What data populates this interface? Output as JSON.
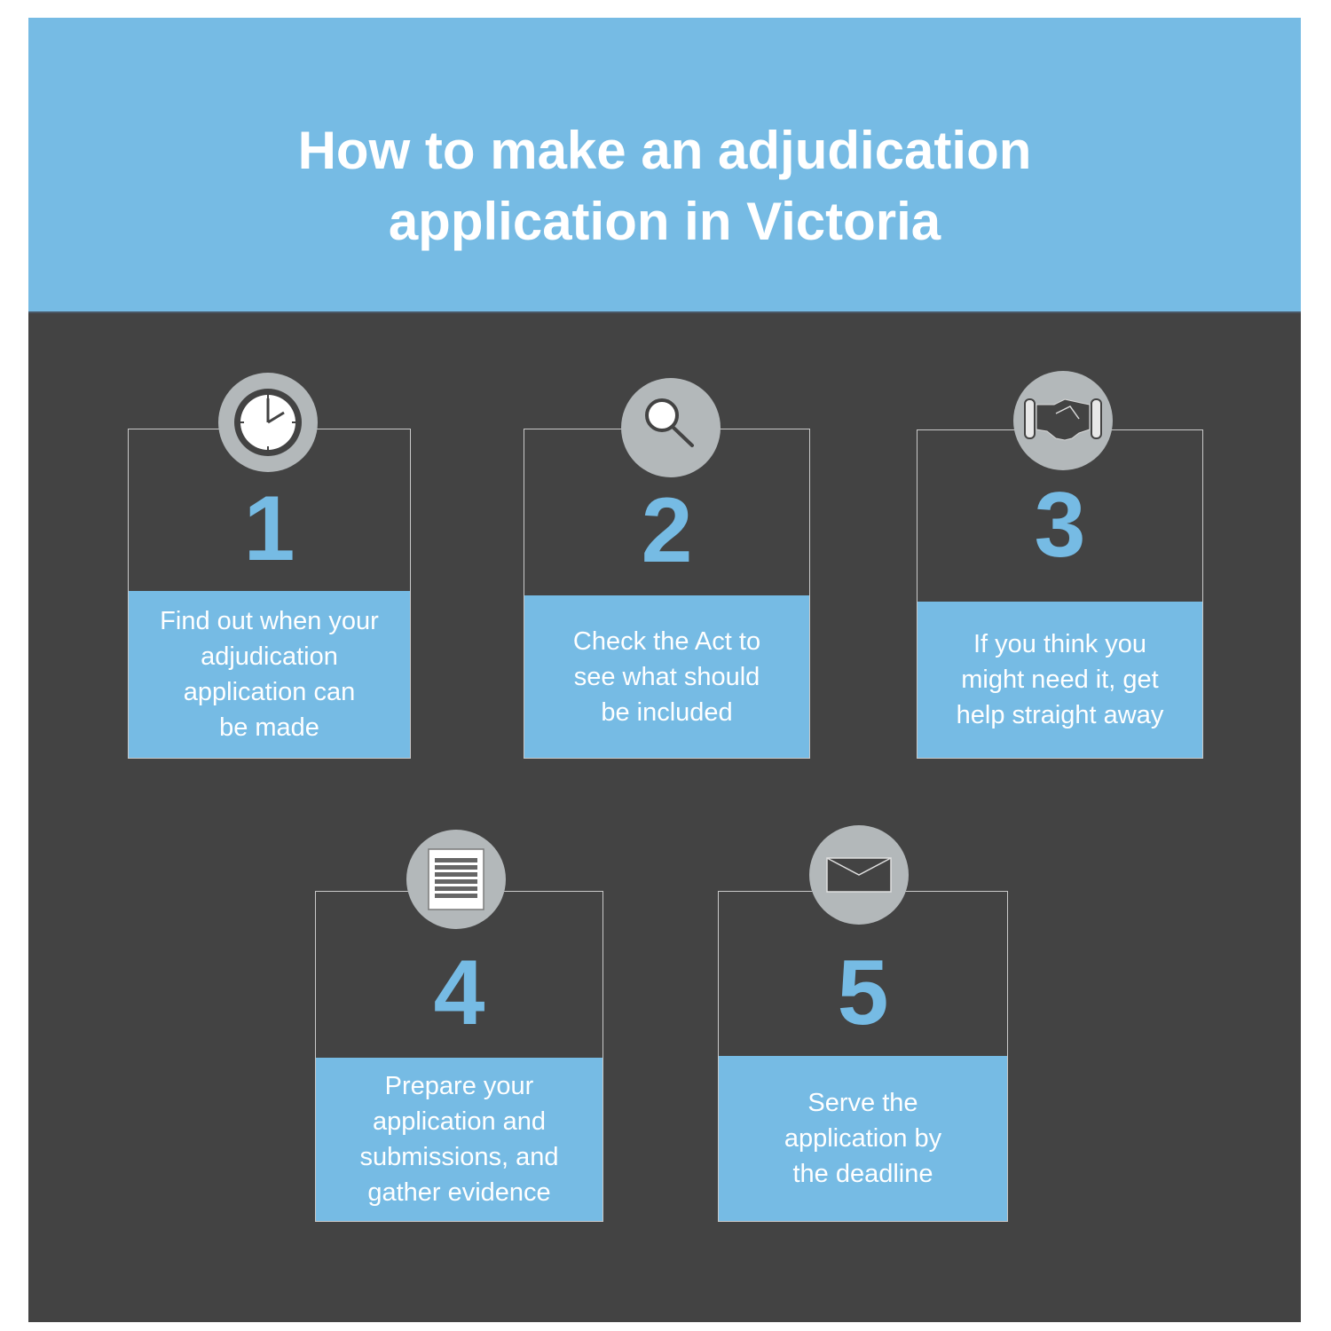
{
  "header": {
    "title_line1": "How to make an adjudication",
    "title_line2": "application in Victoria"
  },
  "colors": {
    "accent_blue": "#76bbe4",
    "panel_dark": "#434343",
    "badge_gray": "#b3b8ba"
  },
  "steps": [
    {
      "number": "1",
      "icon": "clock-icon",
      "lines": [
        "Find out when your",
        "adjudication",
        "application can",
        "be made"
      ]
    },
    {
      "number": "2",
      "icon": "magnifier-icon",
      "lines": [
        "Check the Act to",
        "see what should",
        "be included"
      ]
    },
    {
      "number": "3",
      "icon": "handshake-icon",
      "lines": [
        "If you think you",
        "might need it, get",
        "help straight away"
      ]
    },
    {
      "number": "4",
      "icon": "document-icon",
      "lines": [
        "Prepare your",
        "application and",
        "submissions, and",
        "gather evidence"
      ]
    },
    {
      "number": "5",
      "icon": "envelope-icon",
      "lines": [
        "Serve the",
        "application by",
        "the deadline"
      ]
    }
  ]
}
